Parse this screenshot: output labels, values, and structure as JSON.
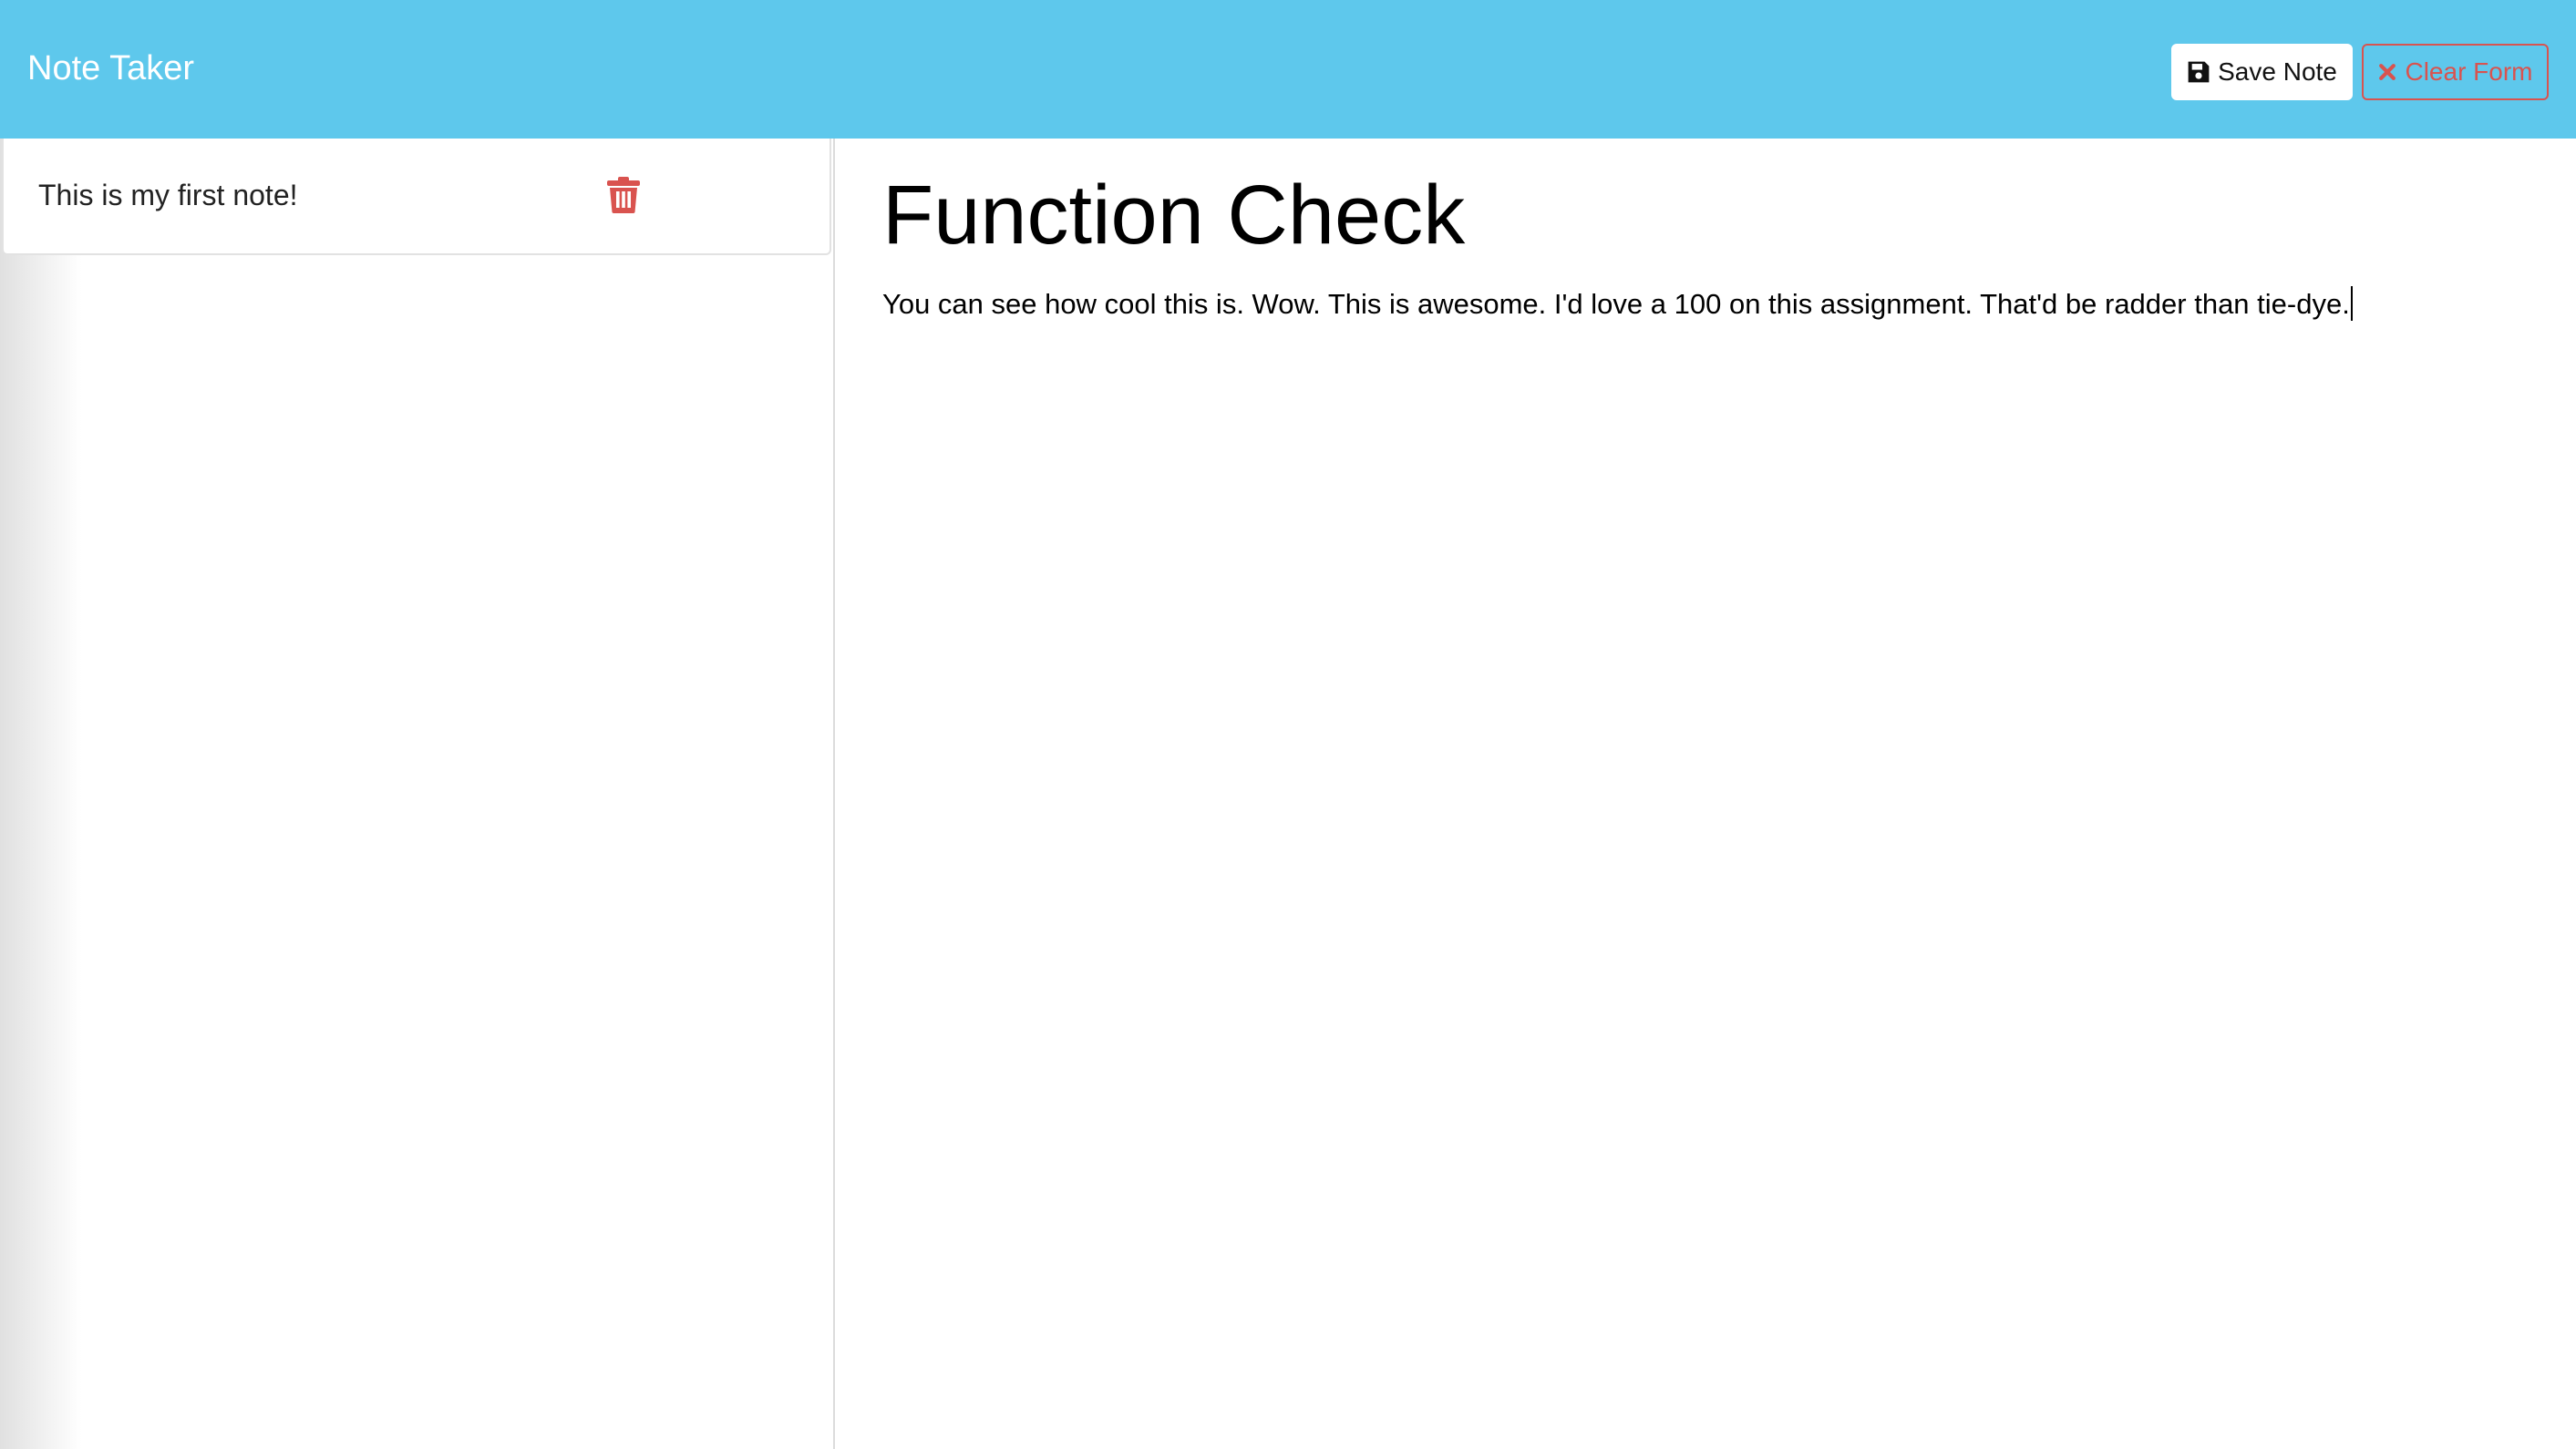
{
  "app": {
    "brand": "Note Taker",
    "accent_color": "#5ec8ec",
    "danger_color": "#d9534f"
  },
  "toolbar": {
    "save_label": "Save Note",
    "save_icon": "floppy-disk-icon",
    "clear_label": "Clear Form",
    "clear_icon": "x-icon"
  },
  "sidebar": {
    "notes": [
      {
        "title": "This is my first note!",
        "delete_icon": "trash-icon"
      }
    ]
  },
  "editor": {
    "title": "Function Check",
    "body": "You can see how cool this is. Wow. This is awesome. I'd love a 100 on this assignment. That'd be radder than tie-dye."
  }
}
